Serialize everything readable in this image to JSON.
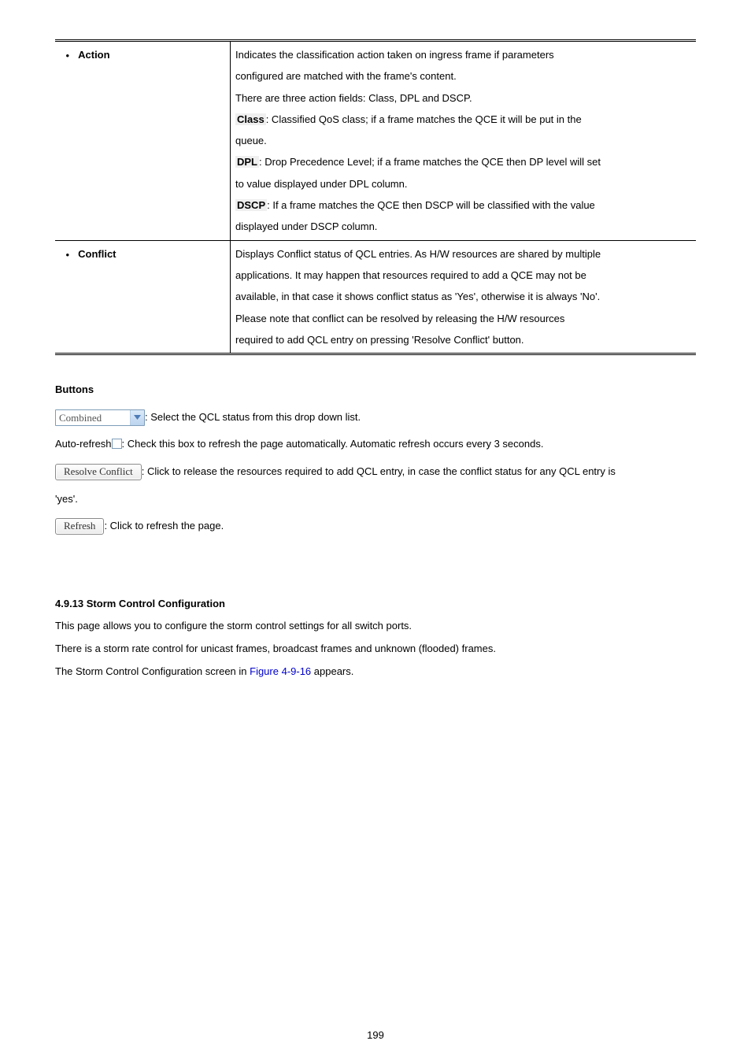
{
  "table": {
    "rows": [
      {
        "label": "Action",
        "lines": [
          {
            "plain": "Indicates the classification action taken on ingress frame if parameters"
          },
          {
            "plain": "configured are matched with the frame's content."
          },
          {
            "plain": "There are three action fields: Class, DPL and DSCP."
          },
          {
            "field": "Class",
            "rest": ": Classified QoS class; if a frame matches the QCE it will be put in the"
          },
          {
            "plain": "queue."
          },
          {
            "field": "DPL",
            "rest": ": Drop Precedence Level; if a frame matches the QCE then DP level will set"
          },
          {
            "plain": "to value displayed under DPL column."
          },
          {
            "field": "DSCP",
            "rest": ": If a frame matches the QCE then DSCP will be classified with the value"
          },
          {
            "plain": "displayed under DSCP column."
          }
        ]
      },
      {
        "label": "Conflict",
        "lines": [
          {
            "plain": "Displays Conflict status of QCL entries. As H/W resources are shared by multiple"
          },
          {
            "plain": "applications. It may happen that resources required to add a QCE may not be"
          },
          {
            "plain": "available, in that case it shows conflict status as 'Yes', otherwise it is always 'No'."
          },
          {
            "plain": "Please note that conflict can be resolved by releasing the H/W resources"
          },
          {
            "plain": "required to add QCL entry on pressing 'Resolve Conflict' button."
          }
        ]
      }
    ]
  },
  "buttons_heading": "Buttons",
  "combo_value": "Combined",
  "combo_desc": ": Select the QCL status from this drop down list.",
  "autorefresh_label": "Auto-refresh",
  "autorefresh_desc": ": Check this box to refresh the page automatically. Automatic refresh occurs every 3 seconds.",
  "resolve_btn": "Resolve Conflict",
  "resolve_desc_a": ": Click to release the resources required to add QCL entry, in case the conflict status for any QCL entry is",
  "resolve_desc_b": "'yes'.",
  "refresh_btn": "Refresh",
  "refresh_desc": ": Click to refresh the page.",
  "storm": {
    "heading": "4.9.13 Storm Control Configuration",
    "p1": "This page allows you to configure the storm control settings for all switch ports.",
    "p2": "There is a storm rate control for unicast frames, broadcast frames and unknown (flooded) frames.",
    "p3_a": "The Storm Control Configuration screen in ",
    "p3_link": "Figure 4-9-16",
    "p3_b": " appears."
  },
  "page_number": "199"
}
